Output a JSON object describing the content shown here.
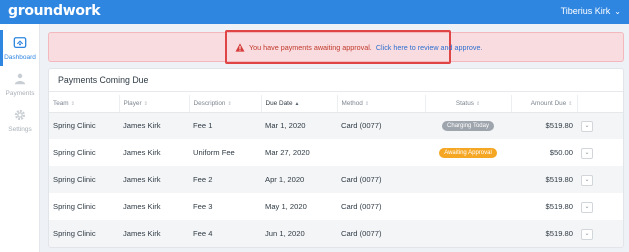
{
  "app": {
    "logo": "groundwork",
    "user_name": "Tiberius Kirk"
  },
  "sidebar": {
    "items": [
      {
        "label": "Dashboard",
        "icon": "dashboard-icon",
        "active": true
      },
      {
        "label": "Payments",
        "icon": "payments-icon",
        "active": false
      },
      {
        "label": "Settings",
        "icon": "gear-icon",
        "active": false
      }
    ]
  },
  "alert": {
    "message": "You have payments awaiting approval.",
    "link_text": "Click here to review and approve."
  },
  "card": {
    "title": "Payments Coming Due",
    "columns": [
      "Team",
      "Player",
      "Description",
      "Due Date",
      "Method",
      "Status",
      "Amount Due"
    ],
    "rows": [
      {
        "team": "Spring Clinic",
        "player": "James Kirk",
        "description": "Fee 1",
        "due_date": "Mar 1, 2020",
        "method": "Card (0077)",
        "status": "Charging Today",
        "amount": "$519.80"
      },
      {
        "team": "Spring Clinic",
        "player": "James Kirk",
        "description": "Uniform Fee",
        "due_date": "Mar 27, 2020",
        "method": "",
        "status": "Awaiting Approval",
        "amount": "$50.00"
      },
      {
        "team": "Spring Clinic",
        "player": "James Kirk",
        "description": "Fee 2",
        "due_date": "Apr 1, 2020",
        "method": "Card (0077)",
        "status": "",
        "amount": "$519.80"
      },
      {
        "team": "Spring Clinic",
        "player": "James Kirk",
        "description": "Fee 3",
        "due_date": "May 1, 2020",
        "method": "Card (0077)",
        "status": "",
        "amount": "$519.80"
      },
      {
        "team": "Spring Clinic",
        "player": "James Kirk",
        "description": "Fee 4",
        "due_date": "Jun 1, 2020",
        "method": "Card (0077)",
        "status": "",
        "amount": "$519.80"
      }
    ]
  },
  "colors": {
    "brand": "#2f86e0",
    "alert_bg": "#f9dcdf",
    "alert_text": "#c0392b",
    "badge_charging": "#9ea5ad",
    "badge_awaiting": "#f5a623"
  }
}
